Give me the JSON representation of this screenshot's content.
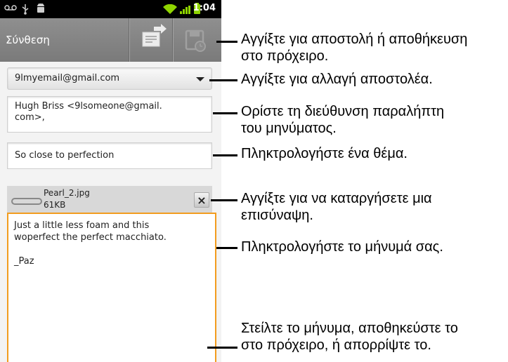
{
  "status_bar": {
    "time": "1:04",
    "icons": [
      "voicemail-icon",
      "usb-icon",
      "android-debug-icon",
      "wifi-icon",
      "signal-icon",
      "battery-charging-icon"
    ]
  },
  "action_bar": {
    "title": "Σύνθεση",
    "buttons": [
      "send-icon",
      "save-draft-icon"
    ]
  },
  "from_account": "9lmyemail@gmail.com",
  "to_line1": "Hugh Briss <9lsomeone@gmail.",
  "to_line2": "com>,",
  "subject": "So close to perfection",
  "attachment": {
    "name": "Pearl_2.jpg",
    "size": "61KB",
    "remove_label": "×"
  },
  "body_lines": [
    "Just a little less foam and this",
    "woperfect the perfect macchiato.",
    "",
    "_Paz"
  ],
  "callouts": [
    {
      "line1": "Αγγίξτε για αποστολή ή αποθήκευση",
      "line2": "στο πρόχειρο."
    },
    {
      "line1": "Αγγίξτε για αλλαγή αποστολέα.",
      "line2": ""
    },
    {
      "line1": "Ορίστε τη διεύθυνση παραλήπτη",
      "line2": "του μηνύματος."
    },
    {
      "line1": "Πληκτρολογήστε ένα θέμα.",
      "line2": ""
    },
    {
      "line1": "Αγγίξτε για να καταργήσετε μια",
      "line2": "επισύναψη."
    },
    {
      "line1": "Πληκτρολογήστε το μήνυμά σας.",
      "line2": ""
    },
    {
      "line1": "Στείλτε το μήνυμα, αποθηκεύστε το",
      "line2": "στο πρόχειρο, ή απορρίψτε το."
    }
  ],
  "colors": {
    "action_bar": "#858585",
    "focus_border": "#f29c1e",
    "signal_green": "#8fd400"
  }
}
